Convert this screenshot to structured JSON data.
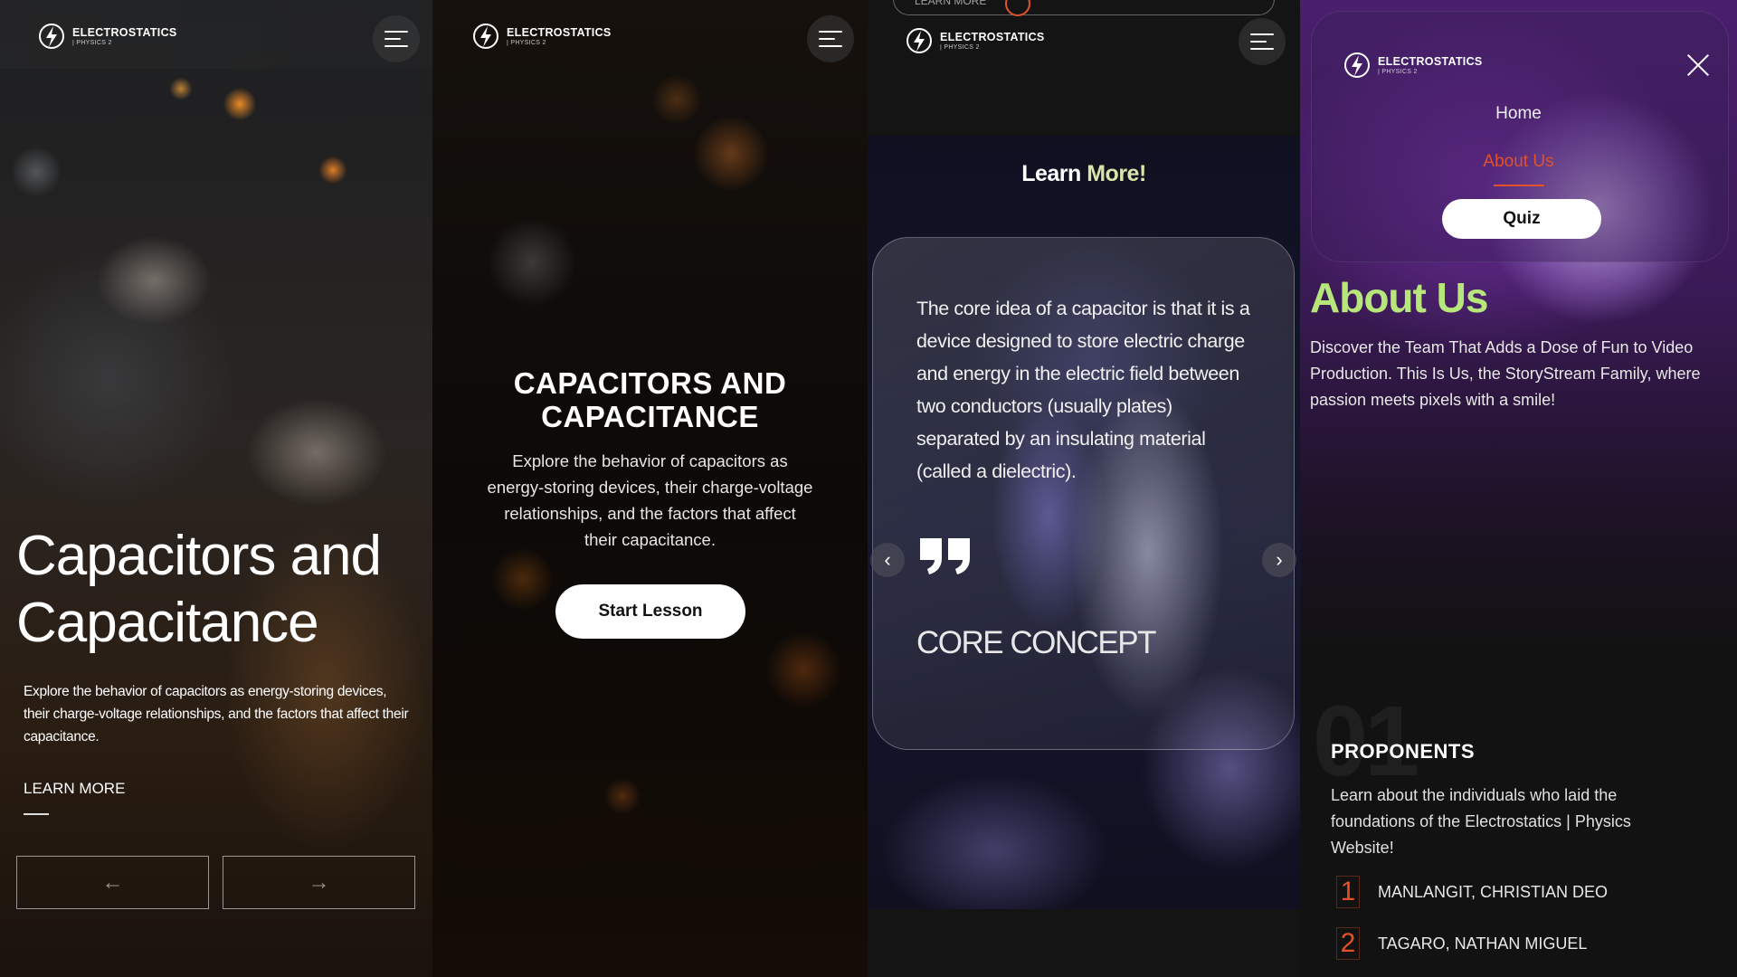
{
  "brand": {
    "title": "ELECTROSTATICS",
    "subtitle": "| PHYSICS 2"
  },
  "panel1": {
    "heading": "Capacitors and Capacitance",
    "description": "Explore the behavior of capacitors as energy-storing devices, their charge-voltage relationships, and the factors that affect their capacitance.",
    "learn_more": "LEARN MORE",
    "prev_arrow": "←",
    "next_arrow": "→"
  },
  "panel2": {
    "heading": "CAPACITORS AND CAPACITANCE",
    "description": "Explore the behavior of capacitors as energy-storing devices, their charge-voltage relationships, and the factors that affect their capacitance.",
    "cta": "Start Lesson"
  },
  "panel3": {
    "peek_text": "LEARN MORE",
    "section_title_part1": "Learn ",
    "section_title_accent": "More!",
    "card_text": "The core idea of a capacitor is that it is a device designed to store electric charge and energy in the electric field between two conductors (usually plates) separated by an insulating material (called a dielectric).",
    "card_label": "CORE CONCEPT",
    "prev": "‹",
    "next": "›"
  },
  "panel4": {
    "nav": {
      "home": "Home",
      "about": "About Us",
      "quiz": "Quiz"
    },
    "about_title": "About Us",
    "about_desc": "Discover the Team That Adds a Dose of Fun to Video Production. This Is Us, the StoryStream Family, where passion meets pixels with a smile!",
    "section_number": "01",
    "proponents_title": "PROPONENTS",
    "proponents_desc": "Learn about the individuals who laid the foundations of the Electrostatics | Physics Website!",
    "members": [
      {
        "num": "1",
        "name": "MANLANGIT, CHRISTIAN DEO"
      },
      {
        "num": "2",
        "name": "TAGARO, NATHAN MIGUEL"
      }
    ]
  },
  "colors": {
    "accent": "#e2522a",
    "green": "#b7e67a",
    "purple": "#4a1f6e"
  }
}
